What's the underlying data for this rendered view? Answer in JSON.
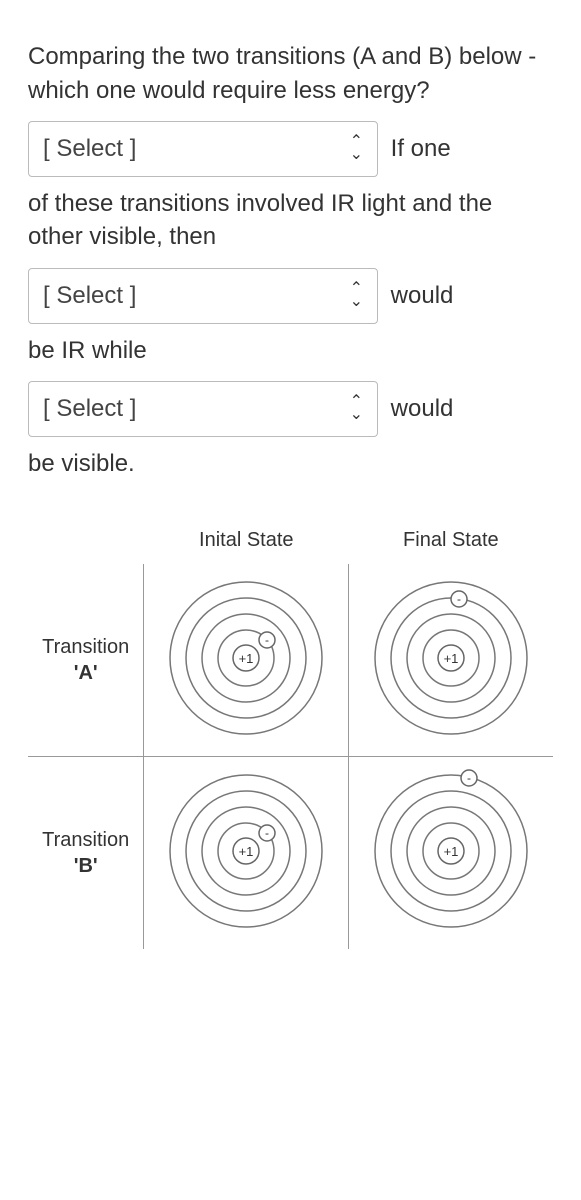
{
  "question": {
    "intro": "Comparing the two transitions (A and B) below - which one would require less energy?",
    "after_select1": "If one",
    "line2": "of these transitions involved IR light and the other visible, then",
    "after_select2": "would",
    "line3": "be IR while",
    "after_select3": "would",
    "line4": "be visible."
  },
  "select_placeholder": "[ Select ]",
  "table": {
    "header_initial": "Inital State",
    "header_final": "Final State",
    "rowA_name": "Transition",
    "rowA_letter": "'A'",
    "rowB_name": "Transition",
    "rowB_letter": "'B'"
  },
  "atom": {
    "nucleus": "+1",
    "electron": "-"
  }
}
